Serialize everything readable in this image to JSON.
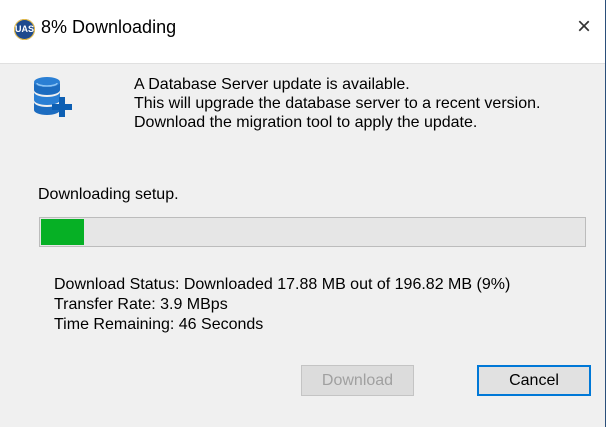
{
  "window": {
    "title": "8% Downloading",
    "app_icon_text": "UAS",
    "close_glyph": "×"
  },
  "message": {
    "line1": "A Database Server update is available.",
    "line2": "This will upgrade the database server to a recent version.",
    "line3": "Download the migration tool to apply the update."
  },
  "progress": {
    "label": "Downloading setup.",
    "percent": 8,
    "fill_color": "#06b025"
  },
  "status": {
    "download_status": "Download Status: Downloaded 17.88 MB out of 196.82 MB (9%)",
    "transfer_rate": "Transfer Rate: 3.9 MBps",
    "time_remaining": "Time Remaining: 46 Seconds"
  },
  "buttons": {
    "download_label": "Download",
    "cancel_label": "Cancel"
  },
  "icons": {
    "database": "database-add-icon"
  }
}
